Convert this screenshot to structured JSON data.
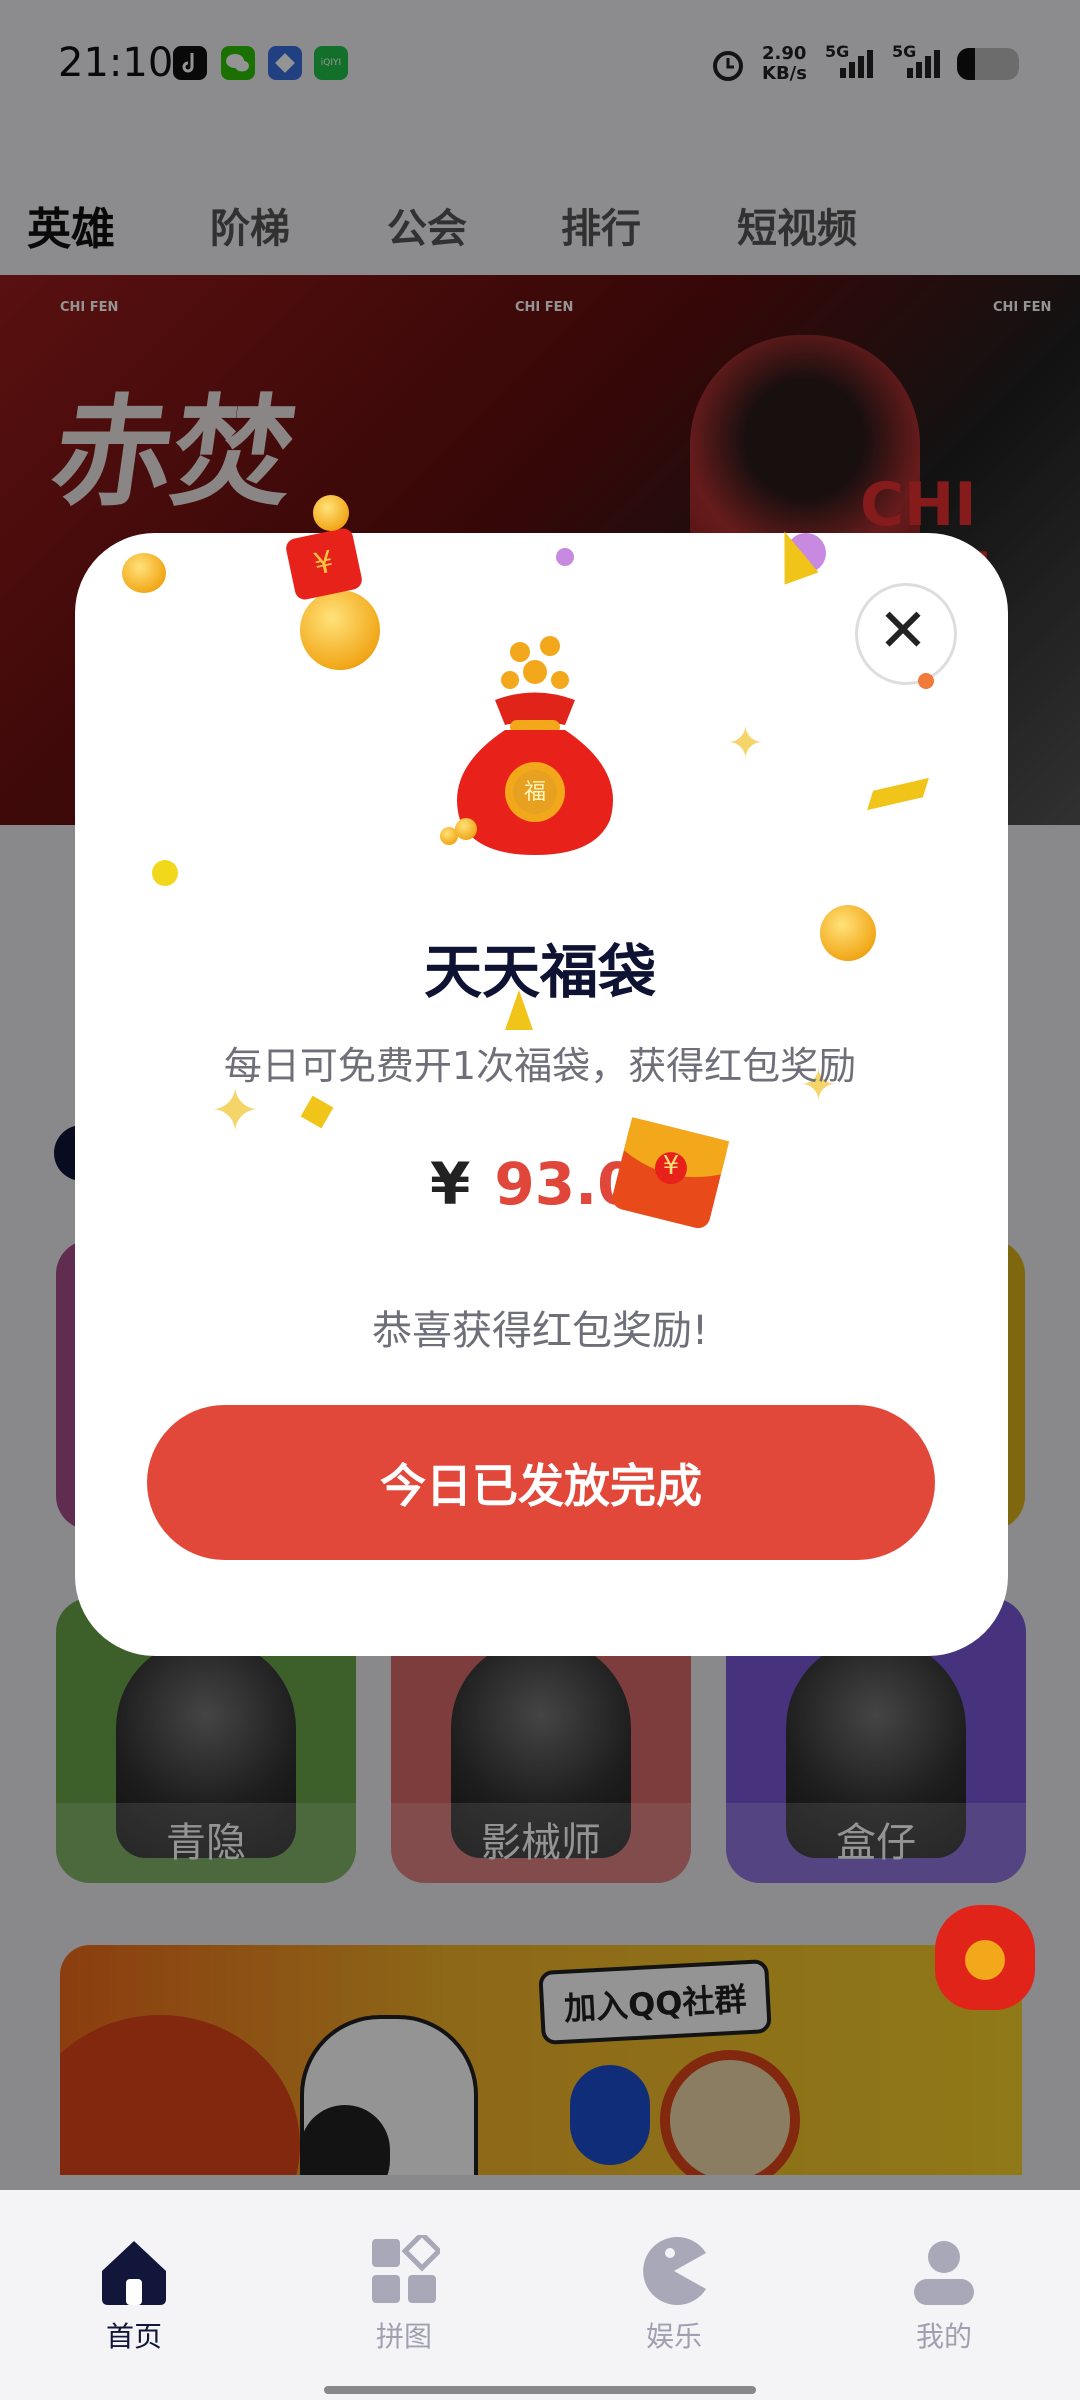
{
  "status_bar": {
    "time": "21:10",
    "network_speed": "2.90",
    "network_unit": "KB/s",
    "sim1": "5G",
    "sim2": "5G",
    "icons": [
      "tiktok-icon",
      "wechat-icon",
      "app-icon",
      "iqiyi-icon",
      "alarm-icon",
      "battery-icon"
    ],
    "iqiyi_label": "iQIYI"
  },
  "tabs": [
    {
      "label": "英雄",
      "active": true
    },
    {
      "label": "阶梯",
      "active": false
    },
    {
      "label": "公会",
      "active": false
    },
    {
      "label": "排行",
      "active": false
    },
    {
      "label": "短视频",
      "active": false
    }
  ],
  "banner": {
    "title": "赤焚",
    "brand": "CHI FEN",
    "watermark": "CHI FEN"
  },
  "cards": [
    {
      "label": "青隐",
      "color": "#6aa64a"
    },
    {
      "label": "影械师",
      "color": "#d96a6a"
    },
    {
      "label": "盒仔",
      "color": "#7a58d8"
    }
  ],
  "qq_banner": {
    "label": "加入QQ社群"
  },
  "modal": {
    "title": "天天福袋",
    "description": "每日可免费开1次福袋，获得红包奖励",
    "currency": "¥",
    "amount": "93.0",
    "congrats": "恭喜获得红包奖励!",
    "button": "今日已发放完成",
    "close_icon": "close-icon",
    "bag_char": "福",
    "envelope_char": "¥"
  },
  "nav": [
    {
      "label": "首页",
      "icon": "home-icon",
      "active": true
    },
    {
      "label": "拼图",
      "icon": "puzzle-icon",
      "active": false
    },
    {
      "label": "娱乐",
      "icon": "pacman-icon",
      "active": false
    },
    {
      "label": "我的",
      "icon": "profile-icon",
      "active": false
    }
  ],
  "colors": {
    "accent_red": "#e1483a",
    "nav_active": "#11163a",
    "nav_inactive": "#a0a0b0"
  }
}
